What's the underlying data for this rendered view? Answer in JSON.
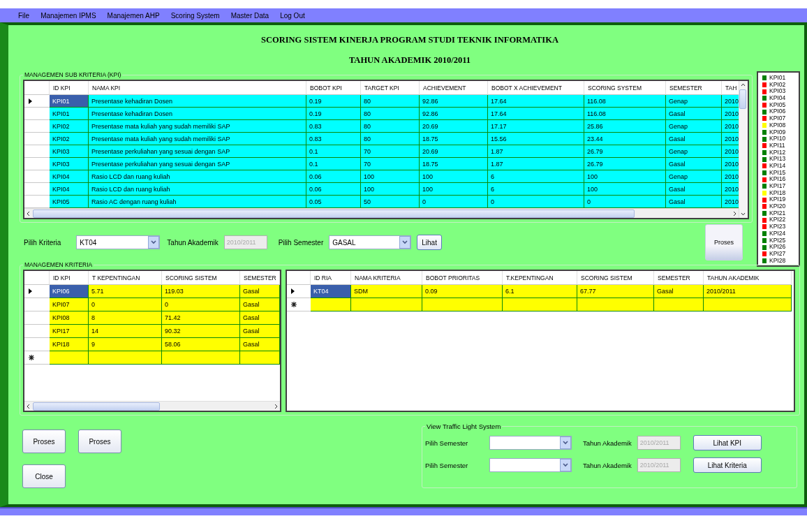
{
  "menu": [
    "File",
    "Manajemen IPMS",
    "Manajemen AHP",
    "Scoring System",
    "Master Data",
    "Log Out"
  ],
  "title_line_1": "SCORING SISTEM KINERJA PROGRAM STUDI TEKNIK INFORMATIKA",
  "title_line_2": "TAHUN AKADEMIK 2010/2011",
  "kpi_group": {
    "title": "MANAGEMEN SUB KRITERIA (KPI)",
    "table": {
      "columns": [
        "ID KPI",
        "NAMA KPI",
        "BOBOT KPI",
        "TARGET KPI",
        "ACHIEVEMENT",
        "BOBOT X ACHIEVEMENT",
        "SCORING SYSTEM",
        "SEMESTER",
        "TAH"
      ],
      "rows": [
        {
          "kind": "data",
          "selected": true,
          "cells": [
            "KPI01",
            "Presentase kehadiran Dosen",
            "0.19",
            "80",
            "92.86",
            "17.64",
            "116.08",
            "Genap",
            "2010"
          ]
        },
        {
          "kind": "data",
          "selected": false,
          "cells": [
            "KPI01",
            "Presentase kehadiran Dosen",
            "0.19",
            "80",
            "92.86",
            "17.64",
            "116.08",
            "Gasal",
            "2010"
          ]
        },
        {
          "kind": "data",
          "selected": false,
          "cells": [
            "KPI02",
            "Presentase mata kuliah yang sudah memiliki SAP",
            "0.83",
            "80",
            "20.69",
            "17.17",
            "25.86",
            "Genap",
            "2010"
          ]
        },
        {
          "kind": "data",
          "selected": false,
          "cells": [
            "KPI02",
            "Presentase mata kuliah yang sudah memiliki SAP",
            "0.83",
            "80",
            "18.75",
            "15.56",
            "23.44",
            "Gasal",
            "2010"
          ]
        },
        {
          "kind": "data",
          "selected": false,
          "cells": [
            "KPI03",
            "Presentase perkuliahan yang sesuai dengan SAP",
            "0.1",
            "70",
            "20.69",
            "1.87",
            "26.79",
            "Genap",
            "2010"
          ]
        },
        {
          "kind": "data",
          "selected": false,
          "cells": [
            "KPI03",
            "Presentase perkuliahan yang sesuai dengan SAP",
            "0.1",
            "70",
            "18.75",
            "1.87",
            "26.79",
            "Gasal",
            "2010"
          ]
        },
        {
          "kind": "data",
          "selected": false,
          "cells": [
            "KPI04",
            "Rasio LCD dan ruang kuliah",
            "0.06",
            "100",
            "100",
            "6",
            "100",
            "Genap",
            "2010"
          ]
        },
        {
          "kind": "data",
          "selected": false,
          "cells": [
            "KPI04",
            "Rasio LCD dan ruang kuliah",
            "0.06",
            "100",
            "100",
            "6",
            "100",
            "Gasal",
            "2010"
          ]
        },
        {
          "kind": "data",
          "selected": false,
          "cells": [
            "KPI05",
            "Rasio AC dengan ruang kuliah",
            "0.05",
            "50",
            "0",
            "0",
            "0",
            "Gasal",
            "2010"
          ]
        }
      ]
    }
  },
  "traffic_legend": [
    {
      "label": "KPI01",
      "color": "#008000"
    },
    {
      "label": "KPI02",
      "color": "#ff0000"
    },
    {
      "label": "KPI03",
      "color": "#ff0000"
    },
    {
      "label": "KPI04",
      "color": "#008000"
    },
    {
      "label": "KPI05",
      "color": "#ff0000"
    },
    {
      "label": "KPI06",
      "color": "#008000"
    },
    {
      "label": "KPI07",
      "color": "#ff0000"
    },
    {
      "label": "KPI08",
      "color": "#ffff00"
    },
    {
      "label": "KPI09",
      "color": "#008000"
    },
    {
      "label": "KPI10",
      "color": "#008000"
    },
    {
      "label": "KPI11",
      "color": "#ff0000"
    },
    {
      "label": "KPI12",
      "color": "#008000"
    },
    {
      "label": "KPI13",
      "color": "#008000"
    },
    {
      "label": "KPI14",
      "color": "#ff0000"
    },
    {
      "label": "KPI15",
      "color": "#008000"
    },
    {
      "label": "KPI16",
      "color": "#ff0000"
    },
    {
      "label": "KPI17",
      "color": "#008000"
    },
    {
      "label": "KPI18",
      "color": "#ffff00"
    },
    {
      "label": "KPI19",
      "color": "#ff0000"
    },
    {
      "label": "KPI20",
      "color": "#ff0000"
    },
    {
      "label": "KPI21",
      "color": "#008000"
    },
    {
      "label": "KPI22",
      "color": "#ff0000"
    },
    {
      "label": "KPI23",
      "color": "#ff0000"
    },
    {
      "label": "KPI24",
      "color": "#008000"
    },
    {
      "label": "KPI25",
      "color": "#008000"
    },
    {
      "label": "KPI26",
      "color": "#008000"
    },
    {
      "label": "KPI27",
      "color": "#ff0000"
    },
    {
      "label": "KPI28",
      "color": "#008000"
    }
  ],
  "filter": {
    "kriteria_label": "Pilih Kriteria",
    "kriteria": {
      "value": "KT04"
    },
    "tahun_label": "Tahun Akademik",
    "tahun": {
      "value": "2010/2011",
      "disabled": true
    },
    "semester_label": "Pilih Semester",
    "semester": {
      "value": "GASAL"
    },
    "lihat_button": "Lihat",
    "proses_button": "Proses"
  },
  "kriteria_group": {
    "title": "MANAGEMEN KRITERIA",
    "left_table": {
      "columns": [
        "ID KPI",
        "T KEPENTINGAN",
        "SCORING SISTEM",
        "SEMESTER"
      ],
      "rows": [
        {
          "kind": "data",
          "selected": true,
          "cells": [
            "KPI06",
            "5.71",
            "119.03",
            "Gasal"
          ]
        },
        {
          "kind": "data",
          "selected": false,
          "cells": [
            "KPI07",
            "0",
            "0",
            "Gasal"
          ]
        },
        {
          "kind": "data",
          "selected": false,
          "cells": [
            "KPI08",
            "8",
            "71.42",
            "Gasal"
          ]
        },
        {
          "kind": "data",
          "selected": false,
          "cells": [
            "KPI17",
            "14",
            "90.32",
            "Gasal"
          ]
        },
        {
          "kind": "data",
          "selected": false,
          "cells": [
            "KPI18",
            "9",
            "58.06",
            "Gasal"
          ]
        },
        {
          "kind": "new",
          "selected": false
        }
      ]
    },
    "right_table": {
      "columns": [
        "ID RIA",
        "NAMA KRITERIA",
        "BOBOT PRIORITAS",
        "T.KEPENTINGAN",
        "SCORING SISTEM",
        "SEMESTER",
        "TAHUN AKADEMIK"
      ],
      "rows": [
        {
          "kind": "data",
          "selected": true,
          "cells": [
            "KT04",
            "SDM",
            "0.09",
            "6.1",
            "67.77",
            "Gasal",
            "2010/2011"
          ]
        },
        {
          "kind": "new",
          "selected": false
        }
      ]
    }
  },
  "bottom_buttons": [
    "Proses",
    "Proses",
    "Close"
  ],
  "traffic_light_group": {
    "title": "View Traffic Light System",
    "rows": [
      {
        "semester_label": "Pilih Semester",
        "tahun_label": "Tahun Akademik",
        "tahun": {
          "value": "2010/2011",
          "disabled": true
        },
        "button": "Lihat KPI"
      },
      {
        "semester_label": "Pilih Semester",
        "tahun_label": "Tahun Akademik",
        "tahun": {
          "value": "2010/2011",
          "disabled": true
        },
        "button": "Lihat Kriteria"
      }
    ]
  }
}
